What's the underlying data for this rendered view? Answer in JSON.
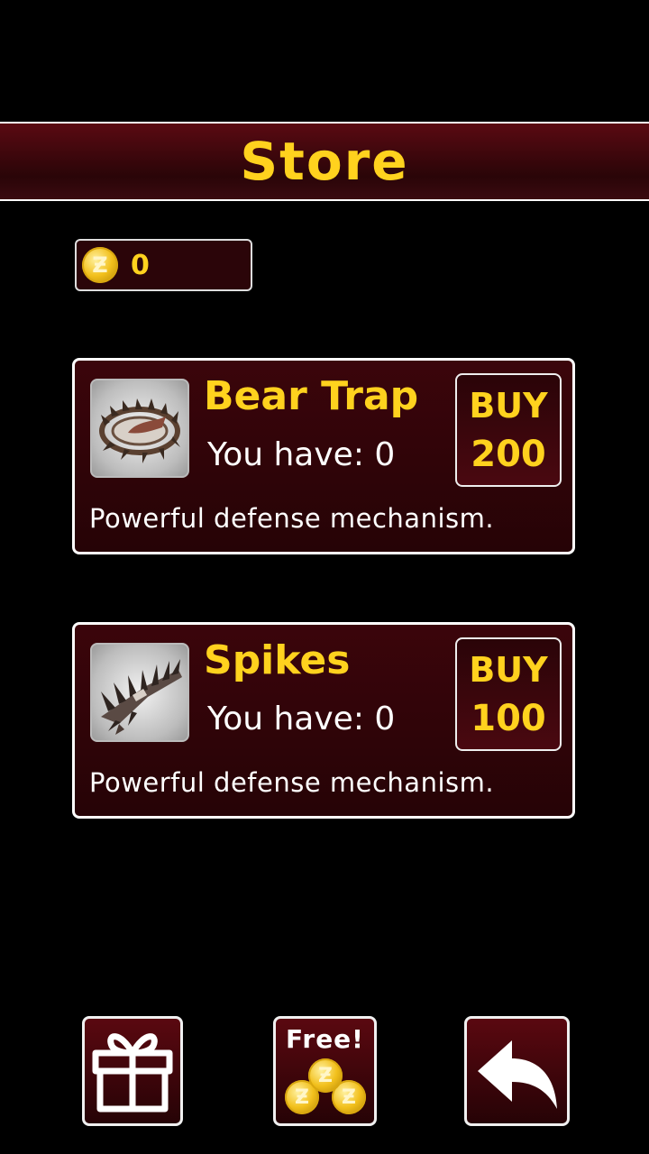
{
  "header": {
    "title": "Store"
  },
  "wallet": {
    "coin_icon": "coin-icon",
    "count": "0"
  },
  "items": [
    {
      "name": "Bear Trap",
      "have": "You have: 0",
      "buy_label": "BUY",
      "price": "200",
      "description": "Powerful defense mechanism.",
      "icon": "bear-trap-icon"
    },
    {
      "name": "Spikes",
      "have": "You have: 0",
      "buy_label": "BUY",
      "price": "100",
      "description": "Powerful defense mechanism.",
      "icon": "spikes-icon"
    }
  ],
  "bottom_bar": {
    "gift_icon": "gift-icon",
    "free_label": "Free!",
    "free_coins_icon": "coins-stack-icon",
    "back_icon": "back-arrow-icon"
  },
  "colors": {
    "accent": "#ffd21e",
    "panel": "#3b050b",
    "background": "#000000"
  }
}
